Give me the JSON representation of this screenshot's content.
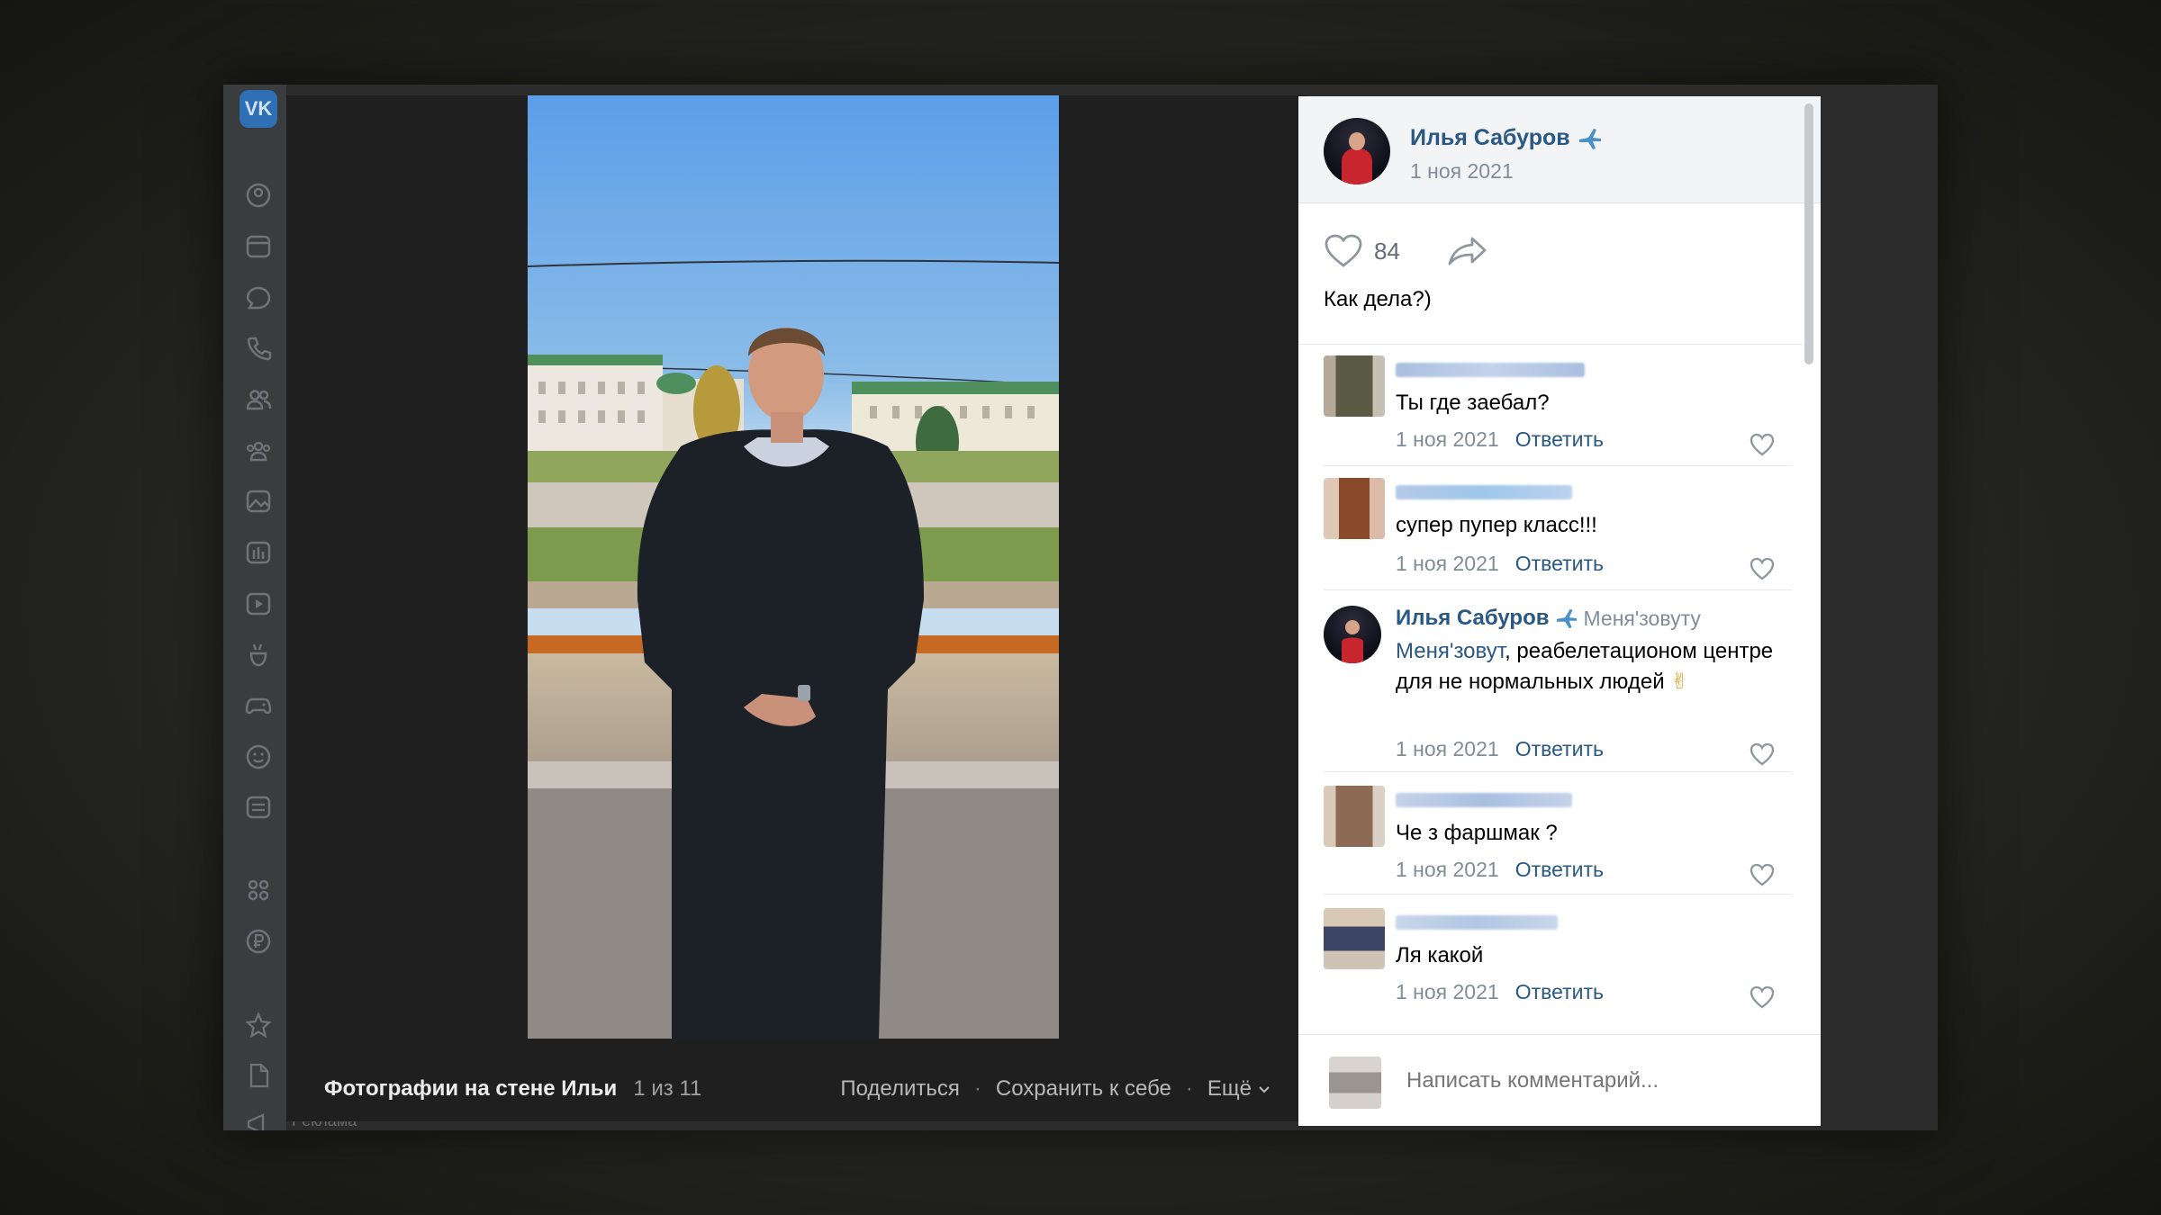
{
  "app": {
    "logo_text": "VK",
    "accent": "#2a5885"
  },
  "sidebar": {
    "icons": [
      "profile-icon",
      "news-icon",
      "messages-icon",
      "calls-icon",
      "friends-icon",
      "communities-icon",
      "photos-icon",
      "music-icon",
      "video-icon",
      "clips-icon",
      "games-icon",
      "stickers-icon",
      "market-icon",
      "services-icon",
      "vk-pay-icon",
      "bookmarks-icon",
      "files-icon",
      "ads-icon"
    ],
    "footer_text": "Реклама"
  },
  "viewer": {
    "album_title": "Фотографии на стене Ильи",
    "counter": "1 из 11",
    "share_label": "Поделиться",
    "save_label": "Сохранить к себе",
    "more_label": "Ещё",
    "separator": "·"
  },
  "post": {
    "author": "Илья Сабуров",
    "date": "1 ноя 2021",
    "likes": "84",
    "text": "Как дела?)"
  },
  "comments": [
    {
      "text": "Ты где заебал?",
      "date": "1 ноя 2021",
      "reply_label": "Ответить"
    },
    {
      "text": "супер пупер класс!!!",
      "date": "1 ноя 2021",
      "reply_label": "Ответить"
    },
    {
      "author": "Илья Сабуров",
      "reply_to": "Меня'зовуту",
      "mention": "Меня'зовут",
      "text": ", реабелетационом центре для не нормальных людей",
      "emoji": "✌",
      "date": "1 ноя 2021",
      "reply_label": "Ответить"
    },
    {
      "text": "Че з фаршмак ?",
      "date": "1 ноя 2021",
      "reply_label": "Ответить"
    },
    {
      "text": "Ля какой",
      "date": "1 ноя 2021",
      "reply_label": "Ответить"
    }
  ],
  "composer": {
    "placeholder": "Написать комментарий..."
  }
}
